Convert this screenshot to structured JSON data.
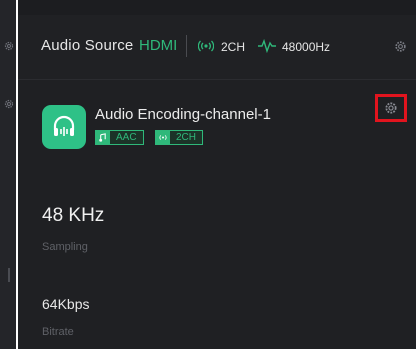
{
  "header": {
    "title": "Audio Source",
    "source": "HDMI",
    "channels": "2CH",
    "sample_rate": "48000Hz"
  },
  "encoding": {
    "title": "Audio Encoding-channel-1",
    "codec_badge": "AAC",
    "channel_badge": "2CH",
    "sampling_value": "48 KHz",
    "sampling_label": "Sampling",
    "bitrate_value": "64Kbps",
    "bitrate_label": "Bitrate"
  },
  "colors": {
    "accent": "#2fb87a",
    "highlight_box": "#e1141e",
    "background": "#1c1d20"
  },
  "icons": [
    "gear-icon",
    "audio-wave-icon",
    "headphones-icon",
    "music-note-icon",
    "broadcast-icon"
  ]
}
